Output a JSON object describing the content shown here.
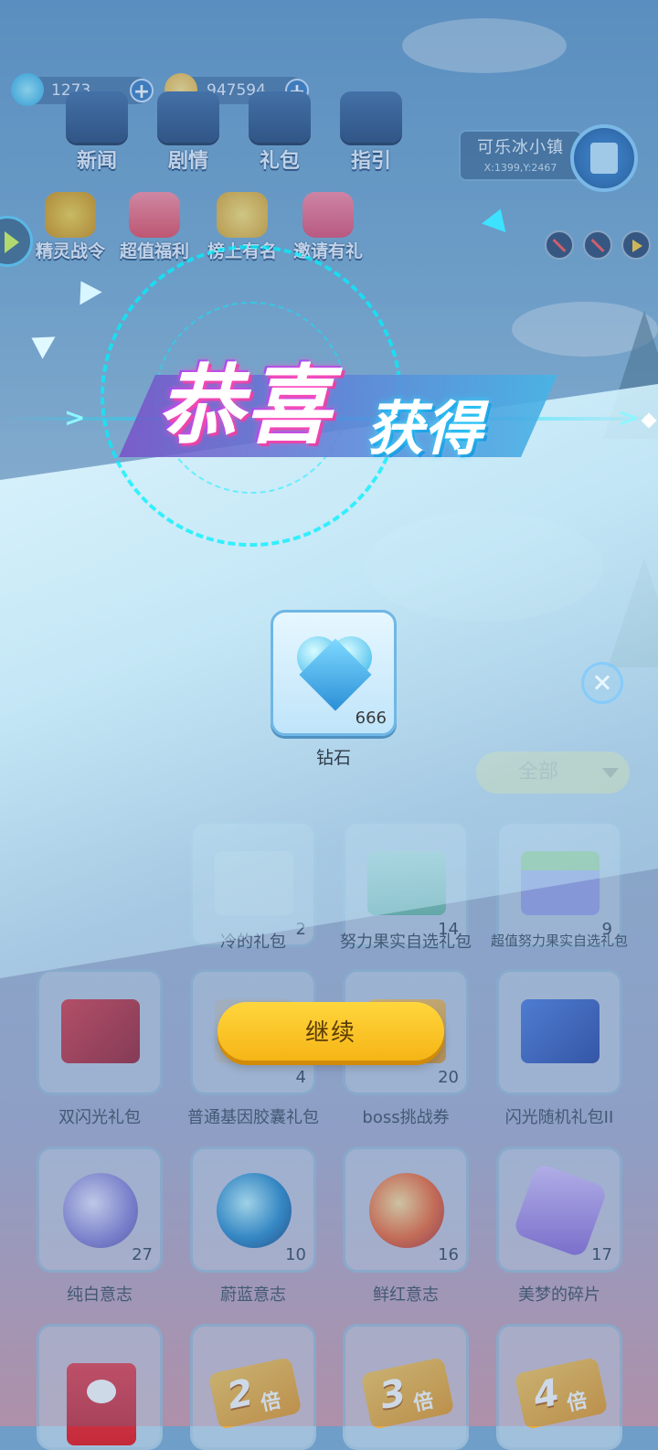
{
  "hud": {
    "diamonds": "1273",
    "coins": "947594",
    "menu": [
      "新闻",
      "剧情",
      "礼包",
      "指引"
    ],
    "activities": [
      "精灵战令",
      "超值福利",
      "榜上有名",
      "邀请有礼"
    ],
    "location": {
      "name": "可乐冰小镇",
      "coords": "X:1399,Y:2467"
    }
  },
  "reward": {
    "title_big": "恭喜",
    "title_small": "获得",
    "item": {
      "name": "钻石",
      "count": "666",
      "icon": "blue-heart-diamond-icon"
    },
    "continue_label": "继续"
  },
  "inventory": {
    "filter_label": "全部",
    "rows": [
      [
        {
          "name": "冷的礼包",
          "count": "2",
          "icon": "chest-icon"
        },
        {
          "name": "努力果实自选礼包",
          "count": "14",
          "icon": "gift-box-icon"
        },
        {
          "name": "超值努力果实自选礼包",
          "count": "9",
          "icon": "fruit-gift-box-icon"
        }
      ],
      [
        {
          "name": "双闪光礼包",
          "count": "",
          "icon": "red-gift-box-icon"
        },
        {
          "name": "普通基因胶囊礼包",
          "count": "4",
          "icon": "capsule-gift-icon"
        },
        {
          "name": "boss挑战券",
          "count": "20",
          "icon": "ticket-icon"
        },
        {
          "name": "闪光随机礼包II",
          "count": "",
          "icon": "blue-gift-box-icon"
        }
      ],
      [
        {
          "name": "纯白意志",
          "count": "27",
          "icon": "white-orb-icon"
        },
        {
          "name": "蔚蓝意志",
          "count": "10",
          "icon": "blue-orb-icon"
        },
        {
          "name": "鲜红意志",
          "count": "16",
          "icon": "red-orb-icon"
        },
        {
          "name": "美梦的碎片",
          "count": "17",
          "icon": "purple-crystal-icon"
        }
      ],
      [
        {
          "name": "",
          "count": "",
          "icon": "red-envelope-icon"
        },
        {
          "name": "",
          "count": "",
          "icon": "double-ticket-icon",
          "badge": "2"
        },
        {
          "name": "",
          "count": "",
          "icon": "triple-ticket-icon",
          "badge": "3"
        },
        {
          "name": "",
          "count": "",
          "icon": "quad-ticket-icon",
          "badge": "4"
        }
      ]
    ],
    "ticket_suffix": "倍"
  },
  "colors": {
    "accent": "#f6b516",
    "neon_cyan": "#00e6ff",
    "neon_pink": "#ff52c8"
  }
}
